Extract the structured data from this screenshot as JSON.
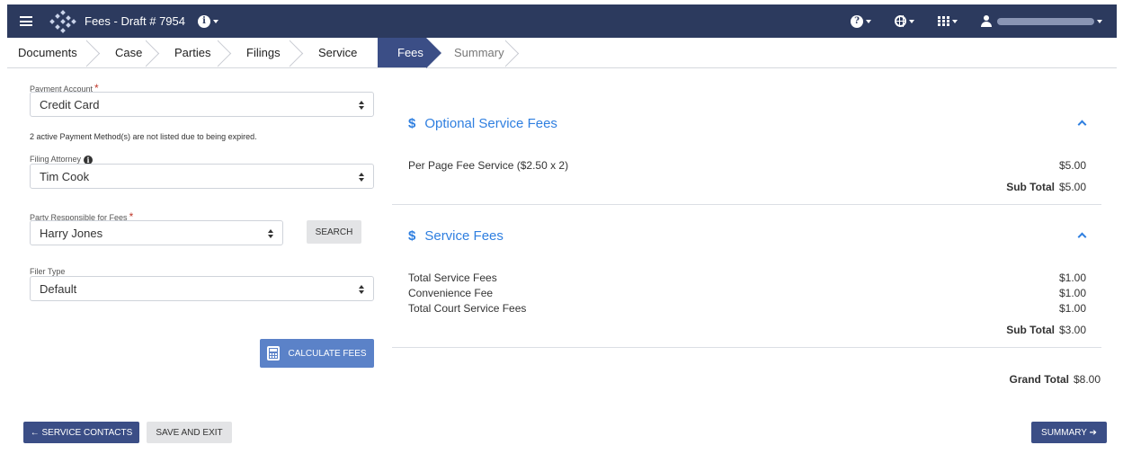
{
  "topbar": {
    "title": "Fees - Draft # 7954",
    "help_icon": "question-circle-icon",
    "language_icon": "globe-icon",
    "apps_icon": "grid-icon",
    "user_icon": "user-icon"
  },
  "steps": [
    {
      "label": "Documents",
      "state": "done"
    },
    {
      "label": "Case",
      "state": "done"
    },
    {
      "label": "Parties",
      "state": "done"
    },
    {
      "label": "Filings",
      "state": "done"
    },
    {
      "label": "Service",
      "state": "done"
    },
    {
      "label": "Fees",
      "state": "active"
    },
    {
      "label": "Summary",
      "state": "upcoming"
    }
  ],
  "form": {
    "payment_account_label": "Payment Account",
    "payment_account_value": "Credit Card",
    "expired_note": "2 active Payment Method(s) are not listed due to being expired.",
    "filing_attorney_label": "Filing Attorney",
    "filing_attorney_value": "Tim Cook",
    "party_label": "Party Responsible for Fees",
    "party_value": "Harry Jones",
    "search_label": "SEARCH",
    "filer_type_label": "Filer Type",
    "filer_type_value": "Default",
    "calculate_label": "CALCULATE FEES"
  },
  "fees": {
    "optional": {
      "title": "Optional Service Fees",
      "items": [
        {
          "name": "Per Page Fee Service ($2.50 x 2)",
          "amount": "$5.00"
        }
      ],
      "subtotal_label": "Sub Total",
      "subtotal_value": "$5.00"
    },
    "service": {
      "title": "Service Fees",
      "items": [
        {
          "name": "Total Service Fees",
          "amount": "$1.00"
        },
        {
          "name": "Convenience Fee",
          "amount": "$1.00"
        },
        {
          "name": "Total Court Service Fees",
          "amount": "$1.00"
        }
      ],
      "subtotal_label": "Sub Total",
      "subtotal_value": "$3.00"
    },
    "grand_total_label": "Grand Total",
    "grand_total_value": "$8.00"
  },
  "footer": {
    "back_label": "← SERVICE CONTACTS",
    "save_exit_label": "SAVE AND EXIT",
    "next_label": "SUMMARY ➔"
  },
  "colors": {
    "navbar": "#2c3a5e",
    "active_step": "#3b4e86",
    "accent_blue": "#2f7fe0",
    "calc_button": "#5b82c8"
  }
}
